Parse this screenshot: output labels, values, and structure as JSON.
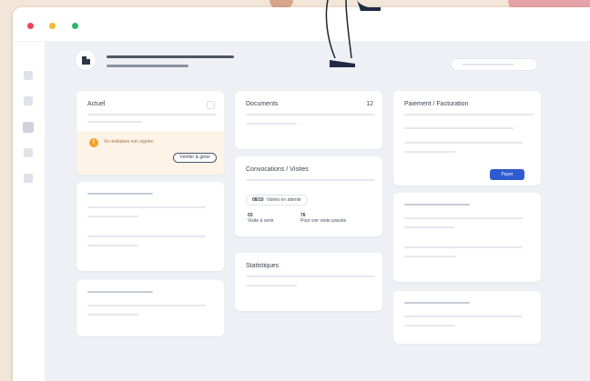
{
  "cards": {
    "actuel": {
      "title": "Actuel",
      "alert_text": "Vo résiliation non signée.",
      "alert_button": "Vérifier & gérer"
    },
    "documents": {
      "title": "Documents",
      "count": "12"
    },
    "paiement": {
      "title": "Paiement / Facturation",
      "button": "Payer"
    },
    "convocations": {
      "title": "Convocations / Visites",
      "pill_num": "08/10",
      "pill_label": "Visites en attente",
      "stat1_num": "03",
      "stat1_label": "Visite à venir",
      "stat2_num": "76",
      "stat2_label": "Pour voir visite passée"
    },
    "statistiques": {
      "title": "Statistiques"
    }
  },
  "colors": {
    "accent": "#2f5bd1",
    "alert_bg": "#fdf3e6",
    "alert_icon": "#f3a228",
    "dot_red": "#f0435a",
    "dot_yellow": "#f7b829",
    "dot_green": "#2db36b"
  },
  "icons": [
    "warning-icon",
    "building-icon"
  ]
}
